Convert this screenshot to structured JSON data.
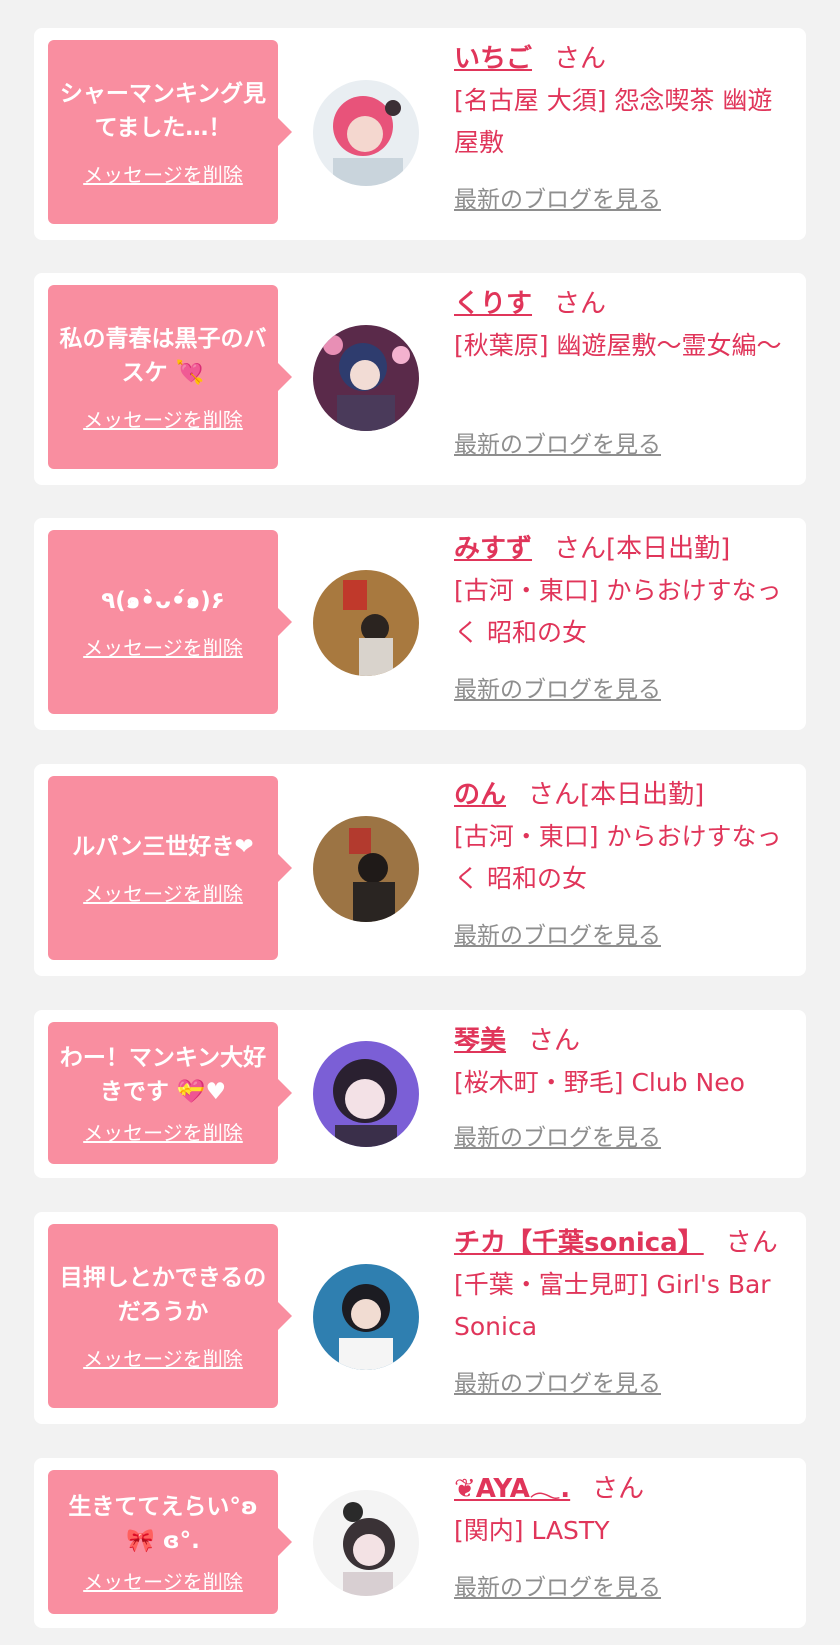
{
  "colors": {
    "page_bg": "#f2f2f2",
    "card_bg": "#ffffff",
    "bubble_bg": "#f98ea0",
    "name_color": "#e0355a",
    "blog_link_color": "#8e8e8e"
  },
  "labels": {
    "delete": "メッセージを削除",
    "blog": "最新のブログを見る",
    "honorific": "さん"
  },
  "cards": [
    {
      "message": "シャーマンキング見てました…！",
      "name": "いちご",
      "status": "",
      "shop": "[名古屋 大須] 怨念喫茶 幽遊屋敷",
      "avatar_icon": "profile-photo-icon"
    },
    {
      "message": "私の青春は黒子のバスケ 💘",
      "name": "くりす",
      "status": "",
      "shop": "[秋葉原] 幽遊屋敷〜霊女編〜",
      "avatar_icon": "profile-photo-icon"
    },
    {
      "message": "٩(๑•̀ᴗ•́๑)۶",
      "name": "みすず",
      "status": "[本日出勤]",
      "shop": "[古河・東口] からおけすなっく 昭和の女",
      "avatar_icon": "profile-photo-icon"
    },
    {
      "message": "ルパン三世好き❤",
      "name": "のん",
      "status": "[本日出勤]",
      "shop": "[古河・東口] からおけすなっく 昭和の女",
      "avatar_icon": "profile-photo-icon"
    },
    {
      "message": "わー！マンキン大好きです 💝♥",
      "name": "琴美",
      "status": "",
      "shop": "[桜木町・野毛] Club Neo",
      "avatar_icon": "profile-photo-icon"
    },
    {
      "message": "目押しとかできるのだろうか",
      "name": "チカ【千葉sonica】",
      "status": "",
      "shop": "[千葉・富士見町] Girl's Bar Sonica",
      "avatar_icon": "profile-photo-icon"
    },
    {
      "message": "生きててえらい°ʚ 🎀 ɞ°.",
      "name": "❦AYA𓂃.",
      "status": "",
      "shop": "[関内] LASTY",
      "avatar_icon": "profile-photo-icon"
    }
  ]
}
